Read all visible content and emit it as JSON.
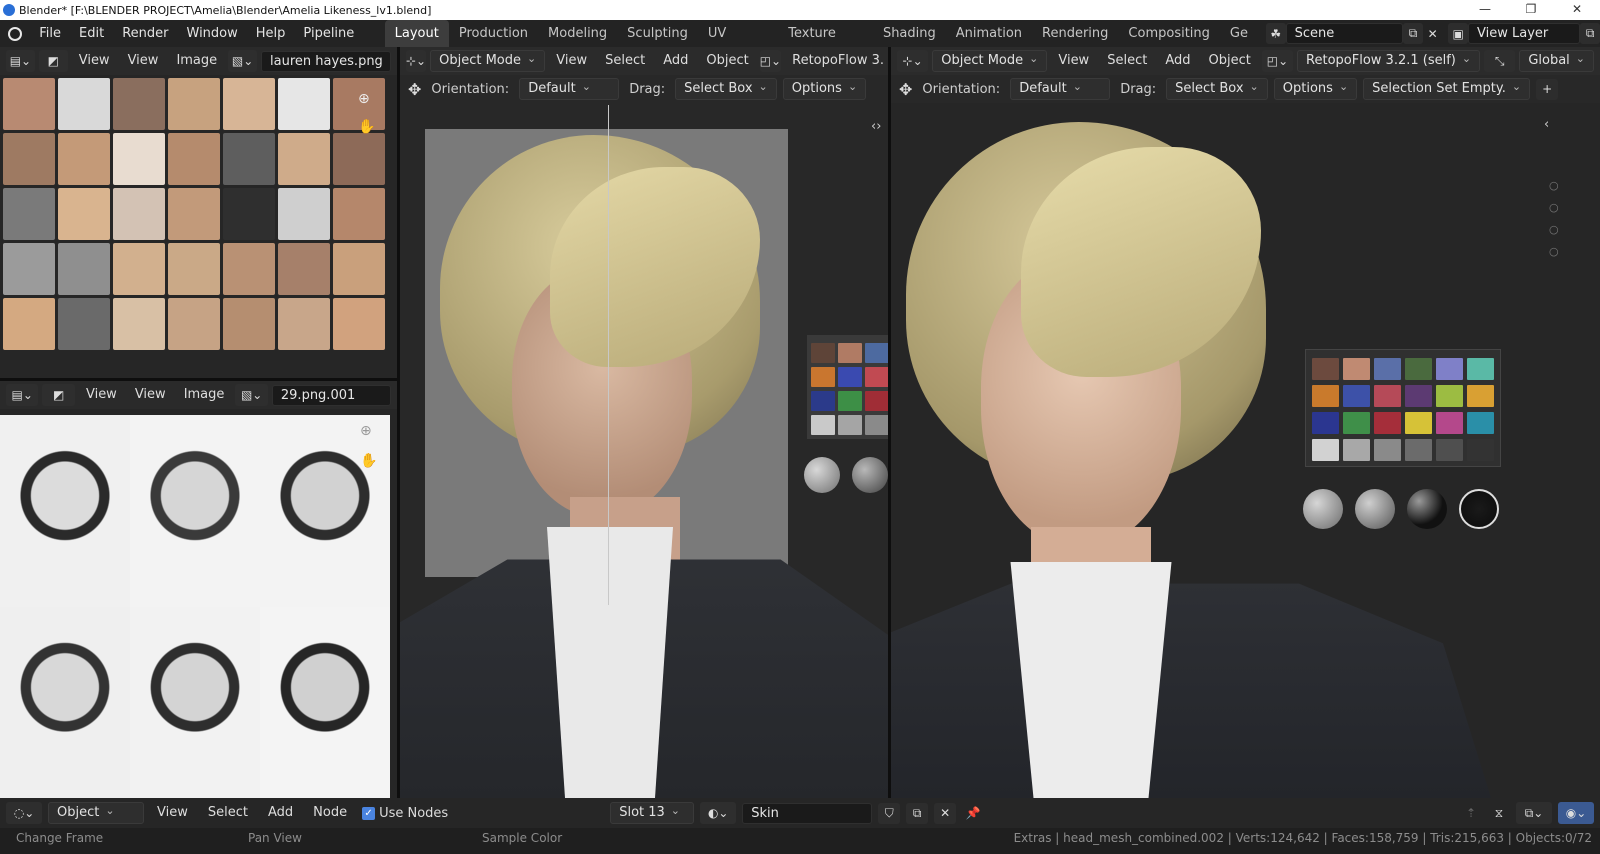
{
  "window": {
    "title": "Blender* [F:\\BLENDER PROJECT\\Amelia\\Blender\\Amelia Likeness_lv1.blend]",
    "controls": [
      "—",
      "❐",
      "✕"
    ]
  },
  "menubar": {
    "items": [
      "File",
      "Edit",
      "Render",
      "Window",
      "Help",
      "Pipeline"
    ]
  },
  "workspaces": {
    "tabs": [
      "Layout",
      "Production",
      "Modeling",
      "Sculpting",
      "UV Editing",
      "Texture Paint",
      "Shading",
      "Animation",
      "Rendering",
      "Compositing",
      "Ge"
    ],
    "active": "Layout"
  },
  "scene": {
    "name": "Scene",
    "view_layer": "View Layer"
  },
  "image_editor_top": {
    "view1": "View",
    "view2": "View",
    "image": "Image",
    "filename": "lauren hayes.png"
  },
  "image_editor_bottom": {
    "view1": "View",
    "view2": "View",
    "image": "Image",
    "filename": "29.png.001"
  },
  "viewport_left": {
    "mode": "Object Mode",
    "menus": [
      "View",
      "Select",
      "Add",
      "Object"
    ],
    "addon": "RetopoFlow 3.",
    "orientation_label": "Orientation:",
    "orientation": "Default",
    "drag_label": "Drag:",
    "drag": "Select Box",
    "options": "Options"
  },
  "viewport_right": {
    "mode": "Object Mode",
    "menus": [
      "View",
      "Select",
      "Add",
      "Object"
    ],
    "addon": "RetopoFlow 3.2.1 (self)",
    "transform": "Global",
    "orientation_label": "Orientation:",
    "orientation": "Default",
    "drag_label": "Drag:",
    "drag": "Select Box",
    "options": "Options",
    "selection_set": "Selection Set Empty."
  },
  "node_header": {
    "object": "Object",
    "menus": [
      "View",
      "Select",
      "Add",
      "Node"
    ],
    "use_nodes": "Use Nodes",
    "slot": "Slot 13",
    "material": "Skin"
  },
  "statusbar": {
    "hint1": "Change Frame",
    "hint2": "Pan View",
    "hint3": "Sample Color",
    "stats": "Extras | head_mesh_combined.002 | Verts:124,642 | Faces:158,759 | Tris:215,663 | Objects:0/72"
  },
  "colors": {
    "accent": "#4a84e0",
    "header_bg": "#2a2a2a",
    "viewport_bg": "#262626",
    "checker_left": [
      "#5e4438",
      "#b07b64",
      "#4d6aa0",
      "#c9762f",
      "#3a4ab0",
      "#c14a52",
      "#2b3a8a",
      "#3d8f46",
      "#a02d36",
      "#c9c9c9",
      "#a5a5a5",
      "#8a8a8a"
    ],
    "checker_right": [
      "#6c4a3e",
      "#c08a72",
      "#5a6fa8",
      "#4a6a3e",
      "#7f80c8",
      "#5ab9a6",
      "#c97a2c",
      "#3d51a8",
      "#b54a58",
      "#5c3a72",
      "#9cbc42",
      "#d9a033",
      "#2b3690",
      "#3f8f49",
      "#a52e3a",
      "#d6c237",
      "#b4488b",
      "#2a8fa8",
      "#d2d2d2",
      "#a8a8a8",
      "#8a8a8a",
      "#6b6b6b",
      "#4f4f4f",
      "#333333"
    ]
  }
}
